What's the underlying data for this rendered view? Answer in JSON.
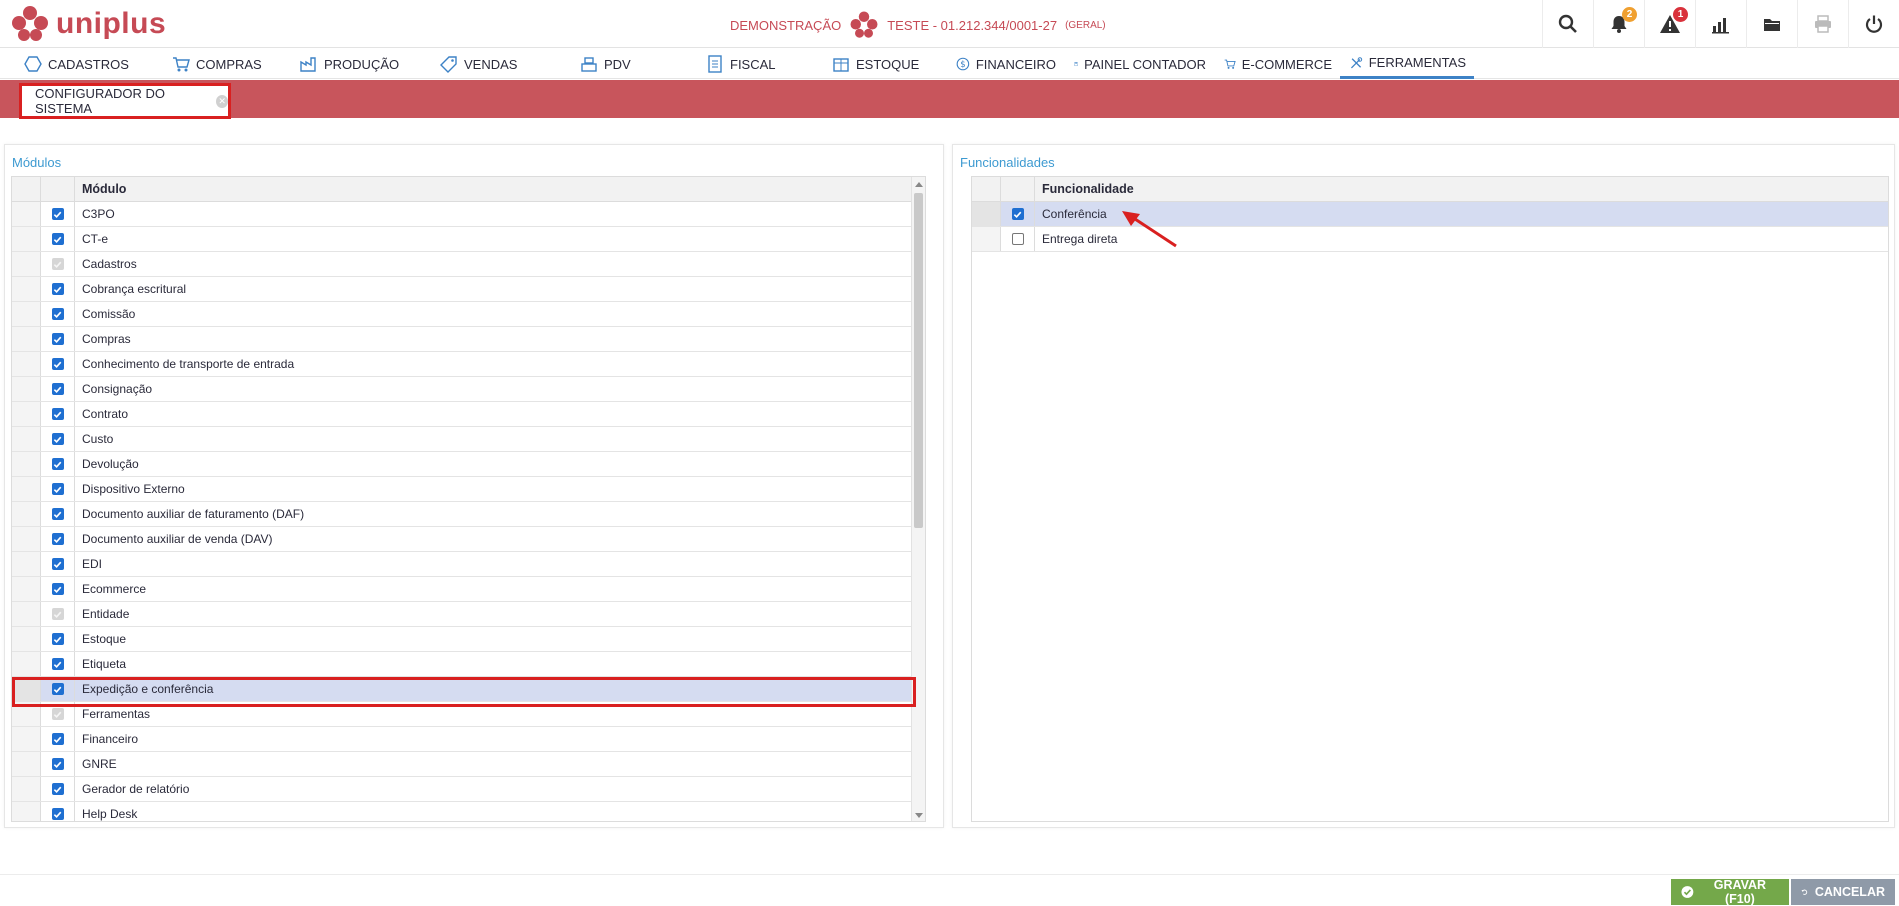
{
  "header": {
    "logo_text": "uniplus",
    "company_demo": "DEMONSTRAÇÃO",
    "company_name": "TESTE - 01.212.344/0001-27",
    "company_tag": "(GERAL)",
    "notifications_count": "2",
    "alerts_count": "1"
  },
  "nav": {
    "items": [
      {
        "label": "CADASTROS"
      },
      {
        "label": "COMPRAS"
      },
      {
        "label": "PRODUÇÃO"
      },
      {
        "label": "VENDAS"
      },
      {
        "label": "PDV"
      },
      {
        "label": "FISCAL"
      },
      {
        "label": "ESTOQUE"
      },
      {
        "label": "FINANCEIRO"
      },
      {
        "label": "PAINEL CONTADOR"
      },
      {
        "label": "E-COMMERCE"
      },
      {
        "label": "FERRAMENTAS"
      }
    ],
    "active": "FERRAMENTAS"
  },
  "tab": {
    "label": "CONFIGURADOR DO SISTEMA"
  },
  "modules": {
    "title": "Módulos",
    "column": "Módulo",
    "rows": [
      {
        "label": "C3PO",
        "state": "on"
      },
      {
        "label": "CT-e",
        "state": "on"
      },
      {
        "label": "Cadastros",
        "state": "dis"
      },
      {
        "label": "Cobrança escritural",
        "state": "on"
      },
      {
        "label": "Comissão",
        "state": "on"
      },
      {
        "label": "Compras",
        "state": "on"
      },
      {
        "label": "Conhecimento de transporte de entrada",
        "state": "on"
      },
      {
        "label": "Consignação",
        "state": "on"
      },
      {
        "label": "Contrato",
        "state": "on"
      },
      {
        "label": "Custo",
        "state": "on"
      },
      {
        "label": "Devolução",
        "state": "on"
      },
      {
        "label": "Dispositivo Externo",
        "state": "on"
      },
      {
        "label": "Documento auxiliar de faturamento (DAF)",
        "state": "on"
      },
      {
        "label": "Documento auxiliar de venda (DAV)",
        "state": "on"
      },
      {
        "label": "EDI",
        "state": "on"
      },
      {
        "label": "Ecommerce",
        "state": "on"
      },
      {
        "label": "Entidade",
        "state": "dis"
      },
      {
        "label": "Estoque",
        "state": "on"
      },
      {
        "label": "Etiqueta",
        "state": "on"
      },
      {
        "label": "Expedição e conferência",
        "state": "on",
        "selected": true
      },
      {
        "label": "Ferramentas",
        "state": "dis"
      },
      {
        "label": "Financeiro",
        "state": "on"
      },
      {
        "label": "GNRE",
        "state": "on"
      },
      {
        "label": "Gerador de relatório",
        "state": "on"
      },
      {
        "label": "Help Desk",
        "state": "on"
      }
    ]
  },
  "features": {
    "title": "Funcionalidades",
    "column": "Funcionalidade",
    "rows": [
      {
        "label": "Conferência",
        "state": "on",
        "selected": true
      },
      {
        "label": "Entrega direta",
        "state": "off"
      }
    ]
  },
  "footer": {
    "save_label": "GRAVAR (F10)",
    "cancel_label": "CANCELAR"
  },
  "colors": {
    "brand": "#c64a55",
    "accent": "#3d9ad1",
    "checkbox": "#1f6fd1",
    "highlight": "#d92020",
    "save": "#74a84a",
    "cancel": "#8f9aa8"
  }
}
